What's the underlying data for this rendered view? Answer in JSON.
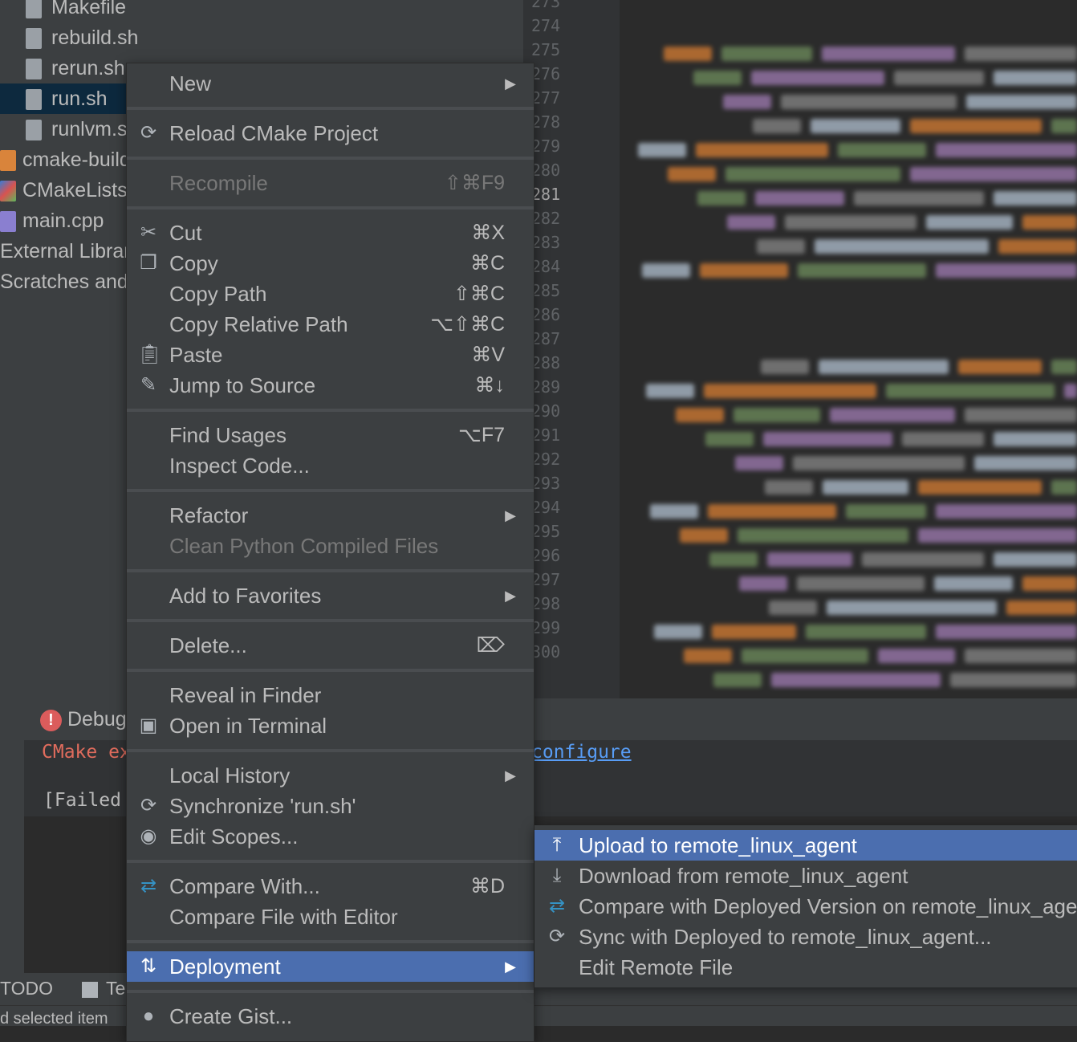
{
  "project_tree": [
    {
      "label": "Makefile",
      "icon": "file-icon"
    },
    {
      "label": "rebuild.sh",
      "icon": "file-icon"
    },
    {
      "label": "rerun.sh",
      "icon": "file-icon"
    },
    {
      "label": "run.sh",
      "icon": "file-icon",
      "selected": true
    },
    {
      "label": "runlvm.sh",
      "icon": "file-icon"
    },
    {
      "label": "cmake-build",
      "icon": "folder-icon"
    },
    {
      "label": "CMakeLists",
      "icon": "cmake-icon"
    },
    {
      "label": "main.cpp",
      "icon": "cpp-file-icon"
    },
    {
      "label": "External Libraries",
      "icon": ""
    },
    {
      "label": "Scratches and Consoles",
      "icon": ""
    }
  ],
  "editor": {
    "line_numbers": [
      "273",
      "274",
      "275",
      "276",
      "277",
      "278",
      "279",
      "280",
      "281",
      "282",
      "283",
      "284",
      "285",
      "286",
      "287",
      "288",
      "289",
      "290",
      "291",
      "292",
      "293",
      "294",
      "295",
      "296",
      "297",
      "298",
      "299",
      "300"
    ],
    "current_line": "281"
  },
  "bottom_panel": {
    "tab_label": "Debug",
    "error_text": "CMake ex",
    "failed_text": "[Failed",
    "link_text": "configure",
    "todo_tab": "TODO",
    "terminal_tab": "Te",
    "status_text": "d selected item"
  },
  "context_menu": {
    "items": [
      {
        "type": "item",
        "label": "New",
        "submenu": true
      },
      {
        "type": "sep"
      },
      {
        "type": "item",
        "label": "Reload CMake Project",
        "icon": "reload-icon"
      },
      {
        "type": "sep"
      },
      {
        "type": "item",
        "label": "Recompile",
        "shortcut": "⇧⌘F9",
        "disabled": true
      },
      {
        "type": "sep"
      },
      {
        "type": "item",
        "label": "Cut",
        "shortcut": "⌘X",
        "icon": "scissors-icon"
      },
      {
        "type": "item",
        "label": "Copy",
        "shortcut": "⌘C",
        "icon": "copy-icon"
      },
      {
        "type": "item",
        "label": "Copy Path",
        "shortcut": "⇧⌘C"
      },
      {
        "type": "item",
        "label": "Copy Relative Path",
        "shortcut": "⌥⇧⌘C"
      },
      {
        "type": "item",
        "label": "Paste",
        "shortcut": "⌘V",
        "icon": "paste-icon"
      },
      {
        "type": "item",
        "label": "Jump to Source",
        "shortcut": "⌘↓",
        "icon": "pencil-icon"
      },
      {
        "type": "sep"
      },
      {
        "type": "item",
        "label": "Find Usages",
        "shortcut": "⌥F7"
      },
      {
        "type": "item",
        "label": "Inspect Code..."
      },
      {
        "type": "sep"
      },
      {
        "type": "item",
        "label": "Refactor",
        "submenu": true
      },
      {
        "type": "item",
        "label": "Clean Python Compiled Files",
        "disabled": true
      },
      {
        "type": "sep"
      },
      {
        "type": "item",
        "label": "Add to Favorites",
        "submenu": true
      },
      {
        "type": "sep"
      },
      {
        "type": "item",
        "label": "Delete...",
        "shortcut": "⌦"
      },
      {
        "type": "sep"
      },
      {
        "type": "item",
        "label": "Reveal in Finder"
      },
      {
        "type": "item",
        "label": "Open in Terminal",
        "icon": "terminal-icon"
      },
      {
        "type": "sep"
      },
      {
        "type": "item",
        "label": "Local History",
        "submenu": true
      },
      {
        "type": "item",
        "label": "Synchronize 'run.sh'",
        "icon": "reload-icon"
      },
      {
        "type": "item",
        "label": "Edit Scopes...",
        "icon": "scope-icon"
      },
      {
        "type": "sep"
      },
      {
        "type": "item",
        "label": "Compare With...",
        "shortcut": "⌘D",
        "icon": "compare-icon"
      },
      {
        "type": "item",
        "label": "Compare File with Editor"
      },
      {
        "type": "sep"
      },
      {
        "type": "item",
        "label": "Deployment",
        "submenu": true,
        "highlighted": true,
        "icon": "deployment-icon"
      },
      {
        "type": "sep"
      },
      {
        "type": "item",
        "label": "Create Gist...",
        "icon": "github-icon"
      }
    ]
  },
  "deployment_submenu": {
    "items": [
      {
        "label": "Upload to remote_linux_agent",
        "icon": "upload-icon",
        "highlighted": true
      },
      {
        "label": "Download from remote_linux_agent",
        "icon": "download-icon"
      },
      {
        "label": "Compare with Deployed Version on remote_linux_agent",
        "icon": "compare-icon"
      },
      {
        "label": "Sync with Deployed to remote_linux_agent...",
        "icon": "reload-icon"
      },
      {
        "label": "Edit Remote File"
      }
    ]
  },
  "colors": {
    "highlight": "#4b6eaf",
    "menu_bg": "#3c3f41",
    "editor_bg": "#2b2b2b",
    "error": "#e06c5d",
    "link": "#589df6"
  }
}
